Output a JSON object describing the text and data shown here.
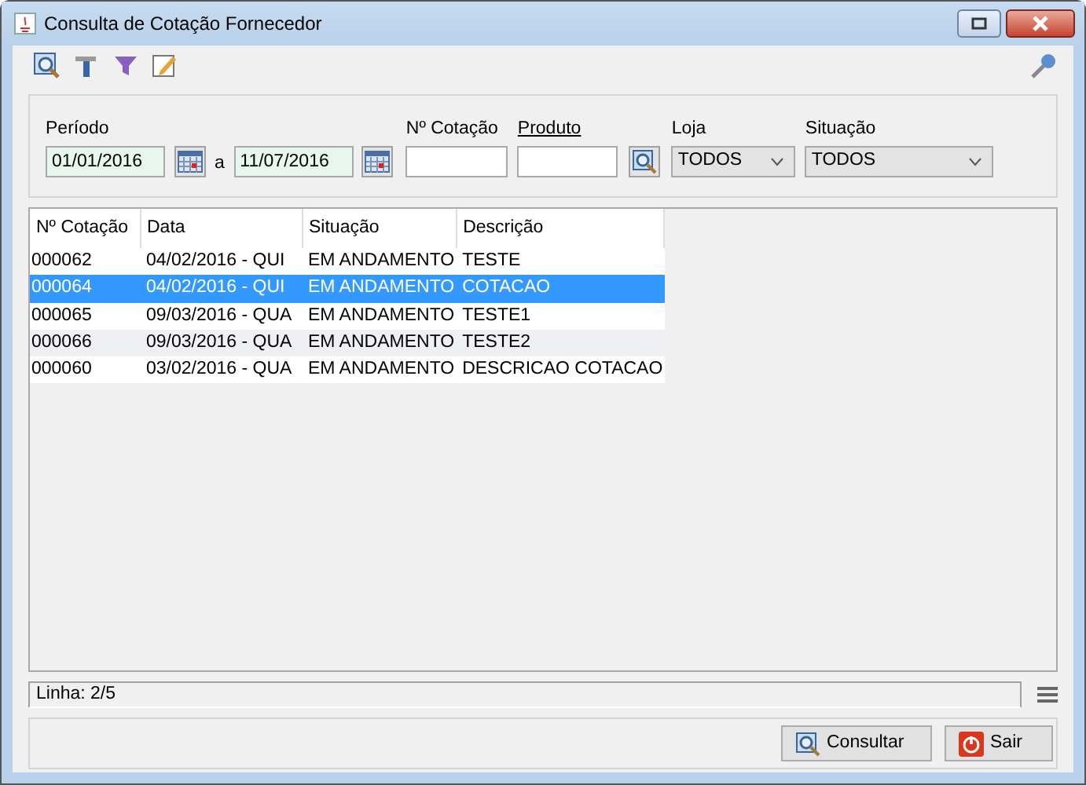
{
  "window": {
    "title": "Consulta de Cotação Fornecedor"
  },
  "filters": {
    "periodo_label": "Período",
    "date_from": "01/01/2016",
    "between": "a",
    "date_to": "11/07/2016",
    "cotacao": {
      "label": "Nº Cotação",
      "kind": "plain"
    },
    "produto": {
      "label": "Produto",
      "kind": "link"
    },
    "loja": {
      "label": "Loja",
      "value": "TODOS"
    },
    "situacao": {
      "label": "Situação",
      "value": "TODOS"
    }
  },
  "table": {
    "columns": [
      "Nº Cotação",
      "Data",
      "Situação",
      "Descrição"
    ],
    "rows": [
      {
        "cells": [
          "000062",
          "04/02/2016 - QUI",
          "EM ANDAMENTO",
          "TESTE"
        ],
        "selected": false
      },
      {
        "cells": [
          "000064",
          "04/02/2016 - QUI",
          "EM ANDAMENTO",
          "COTACAO"
        ],
        "selected": true
      },
      {
        "cells": [
          "000065",
          "09/03/2016 - QUA",
          "EM ANDAMENTO",
          "TESTE1"
        ],
        "selected": false
      },
      {
        "cells": [
          "000066",
          "09/03/2016 - QUA",
          "EM ANDAMENTO",
          "TESTE2"
        ],
        "selected": false
      },
      {
        "cells": [
          "000060",
          "03/02/2016 - QUA",
          "EM ANDAMENTO",
          "DESCRICAO COTACAO"
        ],
        "selected": false
      }
    ]
  },
  "status_bar": "Linha: 2/5",
  "buttons": [
    {
      "label": "Consultar",
      "kind": "search"
    },
    {
      "label": "Sair",
      "kind": "exit"
    }
  ]
}
